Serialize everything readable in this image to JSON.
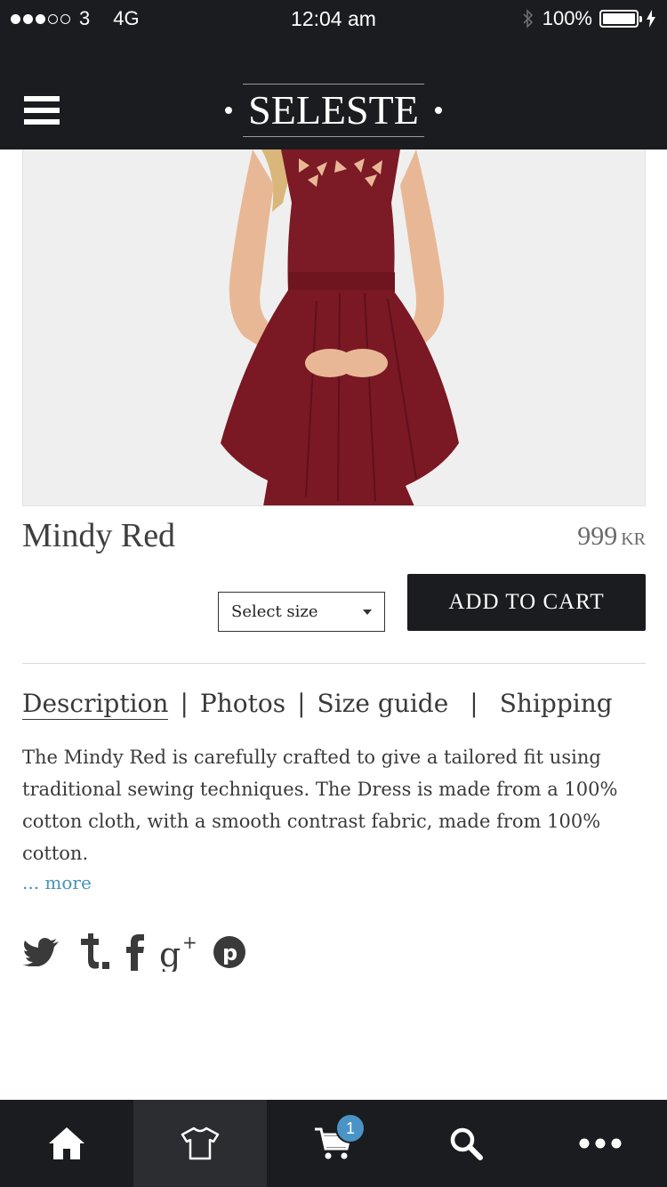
{
  "status_bar": {
    "carrier": "3",
    "network": "4G",
    "time": "12:04 am",
    "battery": "100%"
  },
  "header": {
    "brand": "SELESTE",
    "menu_icon": "hamburger-menu-icon"
  },
  "product": {
    "title": "Mindy Red",
    "price": "999",
    "currency": "KR",
    "image_desc": "woman-wearing-burgundy-dress"
  },
  "actions": {
    "size_select_value": "Select size",
    "add_to_cart_label": "ADD TO CART"
  },
  "tabs": [
    {
      "label": "Description"
    },
    {
      "label": "Photos"
    },
    {
      "label": "Size guide"
    },
    {
      "label": "Shipping"
    }
  ],
  "description": {
    "text": "The Mindy Red is carefully crafted to give a tailored fit using traditional sewing techniques. The Dress is made from a 100% cotton  cloth, with a smooth contrast fabric, made from 100% cotton.",
    "more_link": "... more"
  },
  "social": [
    "twitter-icon",
    "tumblr-icon",
    "facebook-icon",
    "google-plus-icon",
    "pinterest-icon"
  ],
  "tab_bar": {
    "items": [
      "home-icon",
      "tshirt-icon",
      "cart-icon",
      "search-icon",
      "more-icon"
    ],
    "cart_count": "1",
    "colors": {
      "background": "#1b1c20",
      "badge": "#4a93c6",
      "link": "#4a93b7"
    }
  }
}
